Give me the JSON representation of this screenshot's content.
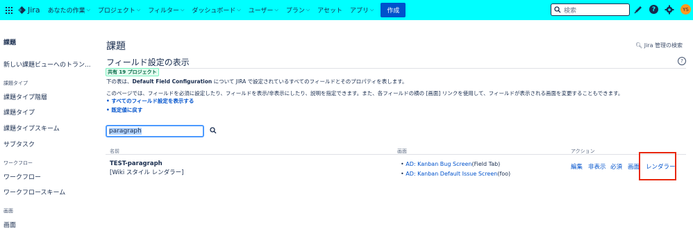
{
  "topnav": {
    "product": "Jira",
    "items": [
      "あなたの作業",
      "プロジェクト",
      "フィルター",
      "ダッシュボード",
      "ユーザー",
      "プラン",
      "アセット",
      "アプリ"
    ],
    "create_label": "作成",
    "search_placeholder": "検索",
    "avatar_initials": "YS"
  },
  "sidebar": {
    "title": "課題",
    "items": [
      {
        "type": "item",
        "label": "新しい課題ビューへのトラン..."
      },
      {
        "type": "head",
        "label": "課題タイプ"
      },
      {
        "type": "item",
        "label": "課題タイプ階層"
      },
      {
        "type": "item",
        "label": "課題タイプ"
      },
      {
        "type": "item",
        "label": "課題タイプスキーム"
      },
      {
        "type": "item",
        "label": "サブタスク"
      },
      {
        "type": "head",
        "label": "ワークフロー"
      },
      {
        "type": "item",
        "label": "ワークフロー"
      },
      {
        "type": "item",
        "label": "ワークフロースキーム"
      },
      {
        "type": "head",
        "label": "画面"
      },
      {
        "type": "item",
        "label": "画面"
      }
    ]
  },
  "main": {
    "page_title": "課題",
    "admin_search": "Jira 管理の検索",
    "section_title": "フィールド設定の表示",
    "shared_badge": "共有 19 プロジェクト",
    "desc1_pre": "下の表は、",
    "desc1_bold": "Default Field Configuration",
    "desc1_post": " について JIRA で設定されているすべてのフィールドとそのプロパティを表します。",
    "desc2": "このページでは、フィールドを必須に設定したり、フィールドを表示/非表示にしたり、説明を指定できます。また、各フィールドの横の [画面] リンクを使用して、フィールドが表示される画面を変更することもできます。",
    "links": [
      "すべてのフィールド設定を表示する",
      "既定値に戻す"
    ],
    "filter_value": "paragraph",
    "table": {
      "headers": [
        "名前",
        "画面",
        "アクション"
      ],
      "rows": [
        {
          "name": "TEST-paragraph",
          "sub": "[Wiki スタイル レンダラー]",
          "screens": [
            {
              "link": "AD: Kanban Bug Screen",
              "suffix": "(Field Tab)"
            },
            {
              "link": "AD: Kanban Default Issue Screen",
              "suffix": "(foo)"
            }
          ],
          "actions": [
            "編集",
            "非表示",
            "必須",
            "画面",
            "レンダラー"
          ]
        }
      ]
    }
  },
  "colors": {
    "topbar": "#00ffff",
    "link": "#0052cc",
    "highlight": "#e8270d"
  }
}
